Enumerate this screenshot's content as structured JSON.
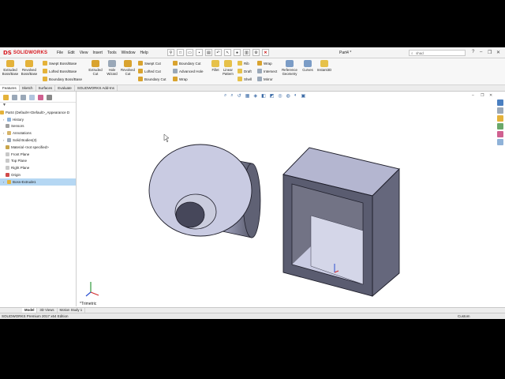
{
  "app": {
    "logo_text": "SOLIDWORKS",
    "menu": [
      "File",
      "Edit",
      "View",
      "Insert",
      "Tools",
      "Window",
      "Help"
    ],
    "document_title": "Part4 *",
    "search_value": "shad"
  },
  "commands": {
    "extruded_boss": "Extruded Boss/Base",
    "revolved_boss": "Revolved Boss/Base",
    "swept_boss": "Swept Boss/Base",
    "lofted_boss": "Lofted Boss/Base",
    "boundary_boss": "Boundary Boss/Base",
    "extruded_cut": "Extruded Cut",
    "hole_wizard": "Hole Wizard",
    "revolved_cut": "Revolved Cut",
    "swept_cut": "Swept Cut",
    "lofted_cut": "Lofted Cut",
    "boundary_cut": "Boundary Cut",
    "boundary_cut2": "Boundary Cut",
    "advanced_hole": "Advanced Hole",
    "wrap": "Wrap",
    "fillet": "Fillet",
    "linear_pattern": "Linear Pattern",
    "rib": "Rib",
    "draft": "Draft",
    "shell": "Shell",
    "wrap2": "Wrap",
    "intersect": "Intersect",
    "mirror": "Mirror",
    "reference_geometry": "Reference Geometry",
    "curves": "Curves",
    "instant3d": "Instant3D"
  },
  "tabs": [
    "Features",
    "Sketch",
    "Surfaces",
    "Evaluate",
    "SOLIDWORKS Add-Ins"
  ],
  "tree": {
    "root": "Part4 (Default<<Default>_Appearance D",
    "items": [
      "History",
      "Sensors",
      "Annotations",
      "Solid Bodies(3)",
      "Material <not specified>",
      "Front Plane",
      "Top Plane",
      "Right Plane",
      "Origin",
      "Boss-Extrude1"
    ]
  },
  "viewport": {
    "view_label": "*Trimetric"
  },
  "bottom_tabs": [
    "Model",
    "3D Views",
    "Motion Study 1"
  ],
  "status": {
    "edition": "SOLIDWORKS Premium 2017 x64 Edition",
    "units": "Custom"
  },
  "colors": {
    "brand": "#d71920",
    "body_fill": "#c9cbe2",
    "selection": "#b5d7f3",
    "taskbar": "#1f2a36"
  }
}
